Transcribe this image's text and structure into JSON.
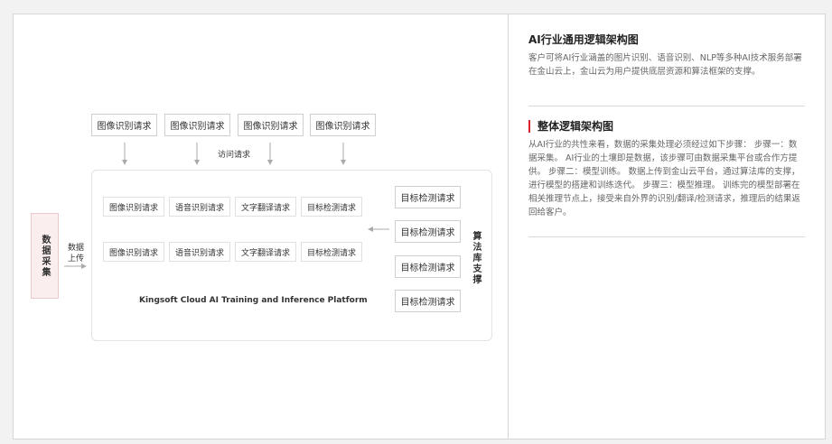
{
  "diagram": {
    "top_requests": [
      "图像识别请求",
      "图像识别请求",
      "图像识别请求",
      "图像识别请求"
    ],
    "access_label": "访问请求",
    "inner_row1": [
      "图像识别请求",
      "语音识别请求",
      "文字翻译请求",
      "目标检测请求"
    ],
    "inner_row2": [
      "图像识别请求",
      "语音识别请求",
      "文字翻译请求",
      "目标检测请求"
    ],
    "detection_requests": [
      "目标检测请求",
      "目标检测请求",
      "目标检测请求",
      "目标检测请求"
    ],
    "data_collection": "数据采集",
    "data_upload": "数据上传",
    "algorithm_support": "算法库支撑",
    "platform_name": "Kingsoft Cloud AI Training and Inference Platform"
  },
  "panel": {
    "section1": {
      "title": "AI行业通用逻辑架构图",
      "text": "客户可将AI行业涵盖的图片识别、语音识别、NLP等多种AI技术服务部署在金山云上，金山云为用户提供底层资源和算法框架的支撑。"
    },
    "section2": {
      "title": "整体逻辑架构图",
      "text": "从AI行业的共性来看，数据的采集处理必须经过如下步骤： 步骤一：数据采集。 AI行业的土壤即是数据，该步骤可由数据采集平台或合作方提供。 步骤二：模型训练。 数据上传到金山云平台，通过算法库的支撑，进行模型的搭建和训练迭代。 步骤三：模型推理。 训练完的模型部署在相关推理节点上，接受来自外界的识别/翻译/检测请求，推理后的结果返回给客户。"
    }
  },
  "colors": {
    "accent": "#d9232e",
    "collect_bg": "#fbeeee"
  }
}
